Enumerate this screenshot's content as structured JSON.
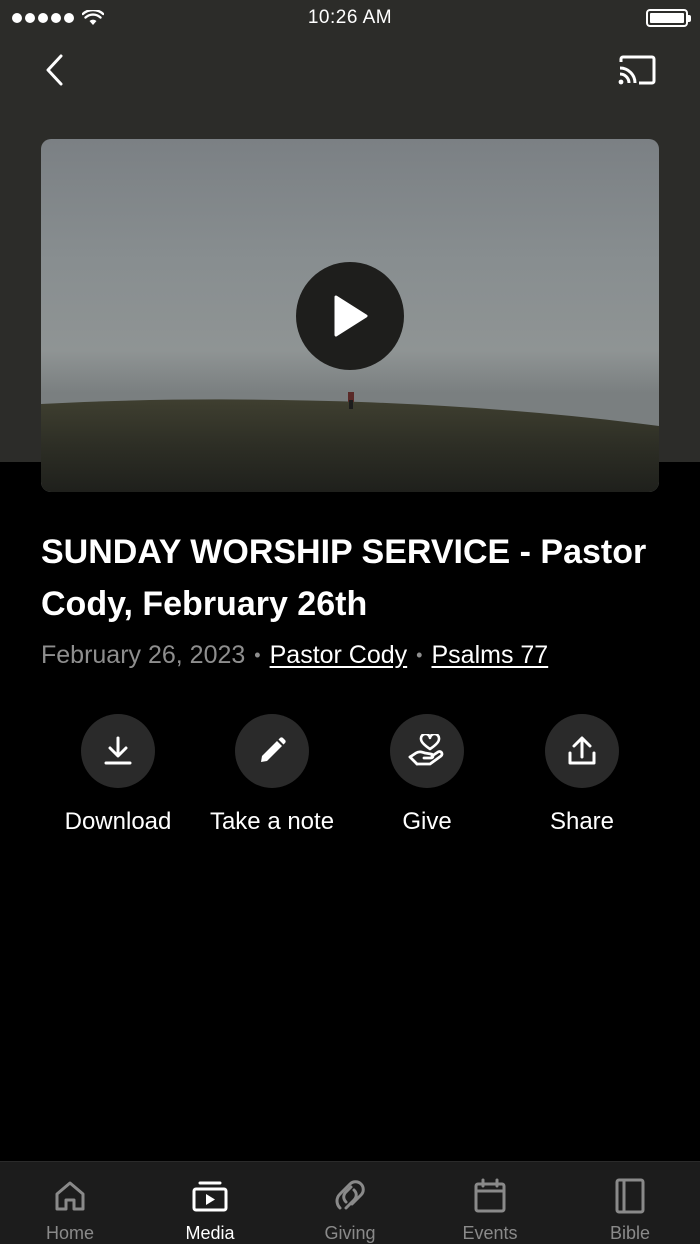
{
  "status_bar": {
    "time": "10:26 AM"
  },
  "video": {
    "title": "SUNDAY WORSHIP SERVICE - Pastor Cody, February 26th",
    "date": "February 26, 2023",
    "speaker": "Pastor Cody",
    "scripture": "Psalms 77"
  },
  "actions": [
    {
      "label": "Download",
      "icon": "download-icon"
    },
    {
      "label": "Take a note",
      "icon": "pencil-icon"
    },
    {
      "label": "Give",
      "icon": "giving-hand-icon"
    },
    {
      "label": "Share",
      "icon": "share-icon"
    }
  ],
  "tabs": [
    {
      "label": "Home",
      "icon": "home-icon",
      "active": false
    },
    {
      "label": "Media",
      "icon": "media-icon",
      "active": true
    },
    {
      "label": "Giving",
      "icon": "giving-icon",
      "active": false
    },
    {
      "label": "Events",
      "icon": "calendar-icon",
      "active": false
    },
    {
      "label": "Bible",
      "icon": "bible-icon",
      "active": false
    }
  ],
  "colors": {
    "header_bg": "#2c2c29",
    "page_bg": "#000000",
    "tab_bar_bg": "#1c1c1c",
    "muted_text": "#8e8e8e"
  }
}
